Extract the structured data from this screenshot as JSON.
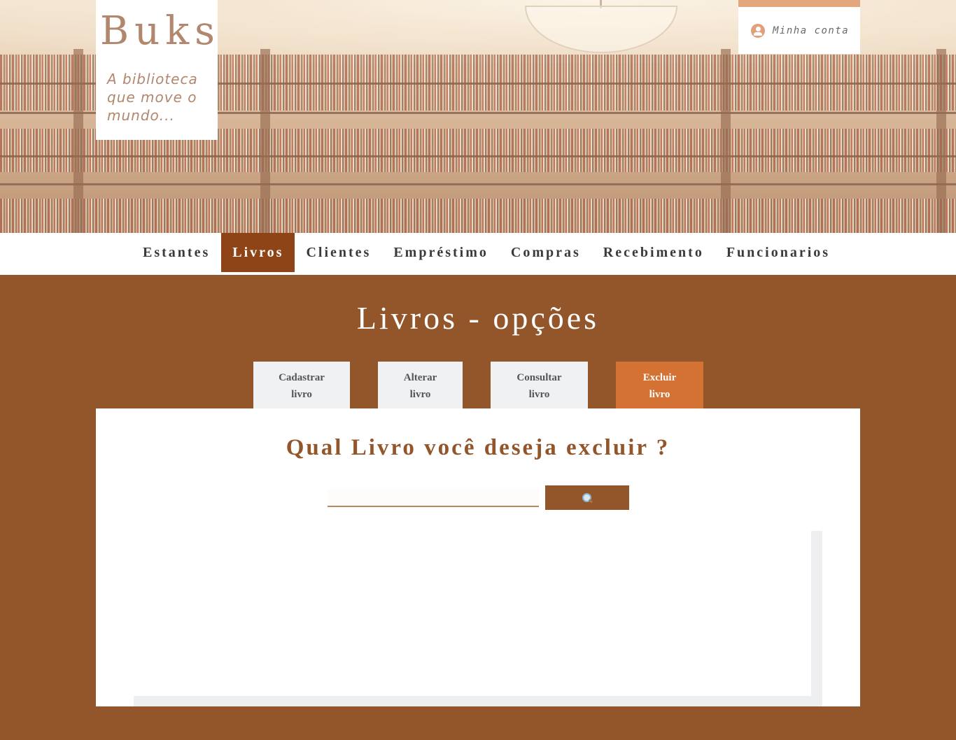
{
  "header": {
    "logo_title": "Buks",
    "tagline": "A biblioteca que move o mundo...",
    "account_label": "Minha conta"
  },
  "nav": {
    "items": [
      {
        "label": "Estantes"
      },
      {
        "label": "Livros"
      },
      {
        "label": "Clientes"
      },
      {
        "label": "Empréstimo"
      },
      {
        "label": "Compras"
      },
      {
        "label": "Recebimento"
      },
      {
        "label": "Funcionarios"
      }
    ],
    "active": "Livros"
  },
  "main": {
    "title": "Livros - opções",
    "tabs": [
      {
        "line1": "Cadastrar",
        "line2": "livro"
      },
      {
        "line1": "Alterar",
        "line2": "livro"
      },
      {
        "line1": "Consultar",
        "line2": "livro"
      },
      {
        "line1": "Excluir",
        "line2": "livro"
      }
    ],
    "active_tab": "Excluir livro",
    "question": "Qual Livro você deseja excluir ?",
    "search": {
      "value": "",
      "placeholder": ""
    },
    "search_button_icon": "search-icon"
  },
  "colors": {
    "brand_brown": "#93552a",
    "nav_active": "#8e4417",
    "tab_active": "#d37232",
    "logo_text": "#b2876d",
    "account_accent": "#e3a77e"
  }
}
